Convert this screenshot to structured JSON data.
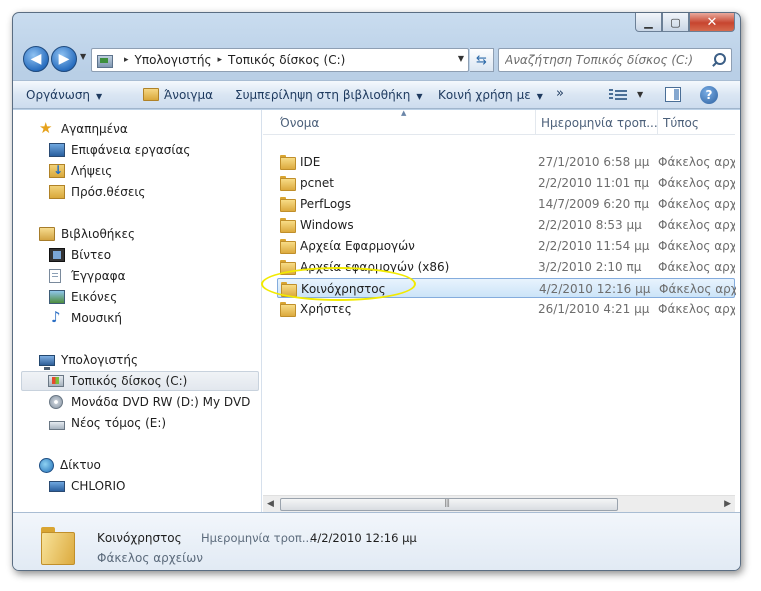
{
  "window": {
    "minimize": "▁",
    "maximize": "▢",
    "close": "✕"
  },
  "address": {
    "crumbs": [
      "Υπολογιστής",
      "Τοπικός δίσκος (C:)"
    ],
    "separator": "▸"
  },
  "search": {
    "placeholder": "Αναζήτηση Τοπικός δίσκος (C:)"
  },
  "toolbar": {
    "organize": "Οργάνωση",
    "open": "Άνοιγμα",
    "include_in_library": "Συμπερίληψη στη βιβλιοθήκη",
    "share_with": "Κοινή χρήση με",
    "more": "»",
    "help": "?"
  },
  "sidebar": {
    "favorites": {
      "label": "Αγαπημένα",
      "items": [
        "Επιφάνεια εργασίας",
        "Λήψεις",
        "Πρόσ.θέσεις"
      ]
    },
    "libraries": {
      "label": "Βιβλιοθήκες",
      "items": [
        "Βίντεο",
        "Έγγραφα",
        "Εικόνες",
        "Μουσική"
      ]
    },
    "computer": {
      "label": "Υπολογιστής",
      "items": [
        "Τοπικός δίσκος (C:)",
        "Μονάδα DVD RW (D:) My DVD",
        "Νέος τόμος (E:)"
      ]
    },
    "network": {
      "label": "Δίκτυο",
      "items": [
        "CHLORIO"
      ]
    }
  },
  "columns": {
    "name": "Όνομα",
    "date": "Ημερομηνία τροπ...",
    "type": "Τύπος"
  },
  "files": [
    {
      "name": "IDE",
      "date": "27/1/2010 6:58 μμ",
      "type": "Φάκελος αρχείων"
    },
    {
      "name": "pcnet",
      "date": "2/2/2010 11:01 πμ",
      "type": "Φάκελος αρχείων"
    },
    {
      "name": "PerfLogs",
      "date": "14/7/2009 6:20 πμ",
      "type": "Φάκελος αρχείων"
    },
    {
      "name": "Windows",
      "date": "2/2/2010 8:53 μμ",
      "type": "Φάκελος αρχείων"
    },
    {
      "name": "Αρχεία Εφαρμογών",
      "date": "2/2/2010 11:54 μμ",
      "type": "Φάκελος αρχείων"
    },
    {
      "name": "Αρχεία εφαρμογών (x86)",
      "date": "3/2/2010 2:10 πμ",
      "type": "Φάκελος αρχείων"
    },
    {
      "name": "Κοινόχρηστος",
      "date": "4/2/2010 12:16 μμ",
      "type": "Φάκελος αρχείων"
    },
    {
      "name": "Χρήστες",
      "date": "26/1/2010 4:21 μμ",
      "type": "Φάκελος αρχείων"
    }
  ],
  "selected_index": 6,
  "details": {
    "name": "Κοινόχρηστος",
    "date_label": "Ημερομηνία τροπ...",
    "date": "4/2/2010 12:16 μμ",
    "type": "Φάκελος αρχείων"
  },
  "colors": {
    "highlight_oval": "#f2ea00",
    "selection_border": "#84acdd"
  }
}
